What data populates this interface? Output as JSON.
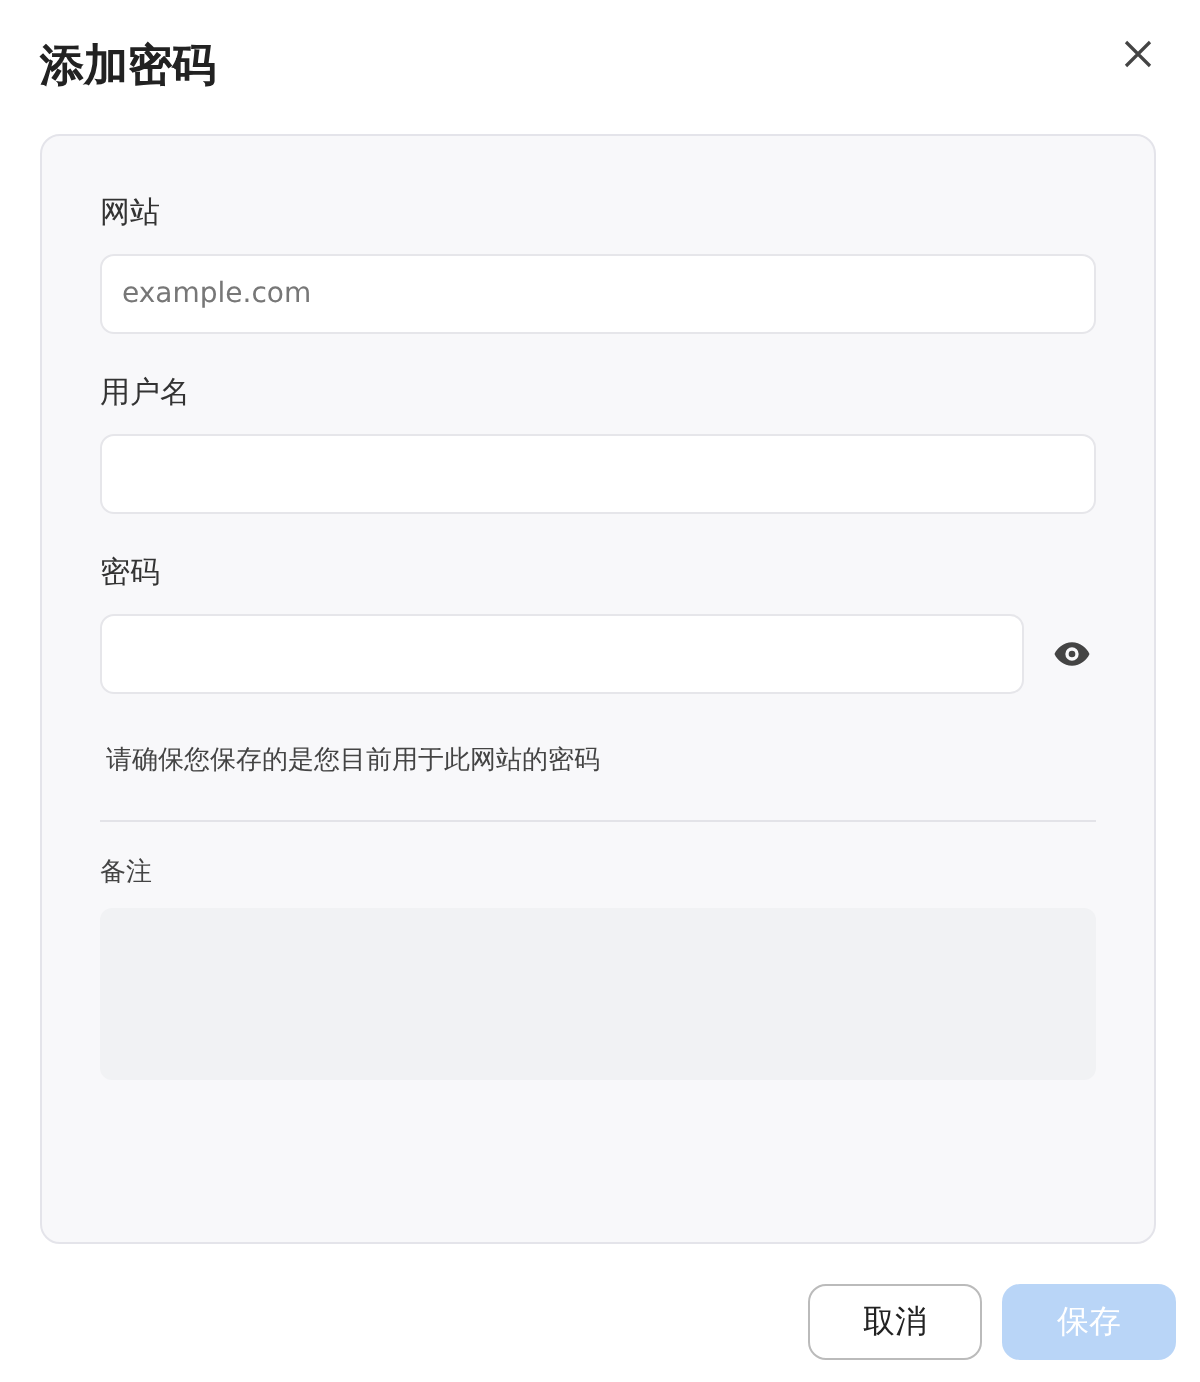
{
  "dialog": {
    "title": "添加密码"
  },
  "fields": [
    {
      "kind": "text",
      "label": "网站",
      "placeholder": "example.com"
    },
    {
      "kind": "text",
      "label": "用户名"
    },
    {
      "kind": "password",
      "label": "密码"
    }
  ],
  "hint": "请确保您保存的是您目前用于此网站的密码",
  "notes": {
    "label": "备注"
  },
  "buttons": [
    {
      "kind": "secondary",
      "label": "取消",
      "disabled": false
    },
    {
      "kind": "primary",
      "label": "保存",
      "disabled": true
    }
  ]
}
